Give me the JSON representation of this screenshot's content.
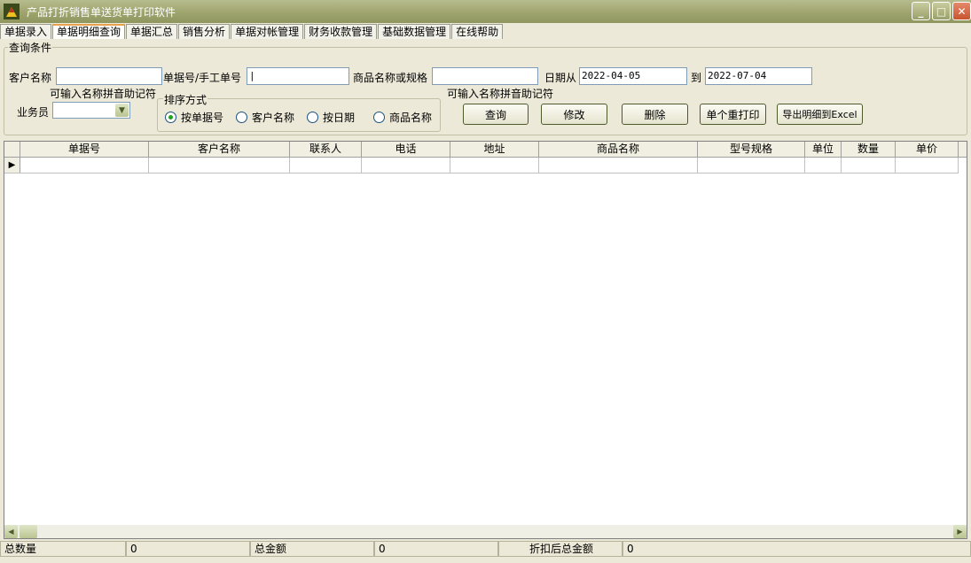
{
  "window": {
    "title": "产品打折销售单送货单打印软件",
    "buttons": {
      "minimize": "_",
      "maximize": "□",
      "close": "✕"
    }
  },
  "tabs": [
    {
      "label": "单据录入"
    },
    {
      "label": "单据明细查询",
      "active": true
    },
    {
      "label": "单据汇总"
    },
    {
      "label": "销售分析"
    },
    {
      "label": "单据对帐管理"
    },
    {
      "label": "财务收款管理"
    },
    {
      "label": "基础数据管理"
    },
    {
      "label": "在线帮助"
    }
  ],
  "query": {
    "group_title": "查询条件",
    "customer_label": "客户名称",
    "customer_value": "",
    "hint_left": "可输入名称拼音助记符",
    "doc_no_label": "单据号/手工单号",
    "doc_no_value": "|",
    "product_label": "商品名称或规格",
    "product_value": "",
    "hint_right": "可输入名称拼音助记符",
    "date_from_label": "日期从",
    "date_from": "2022-04-05",
    "date_to_label": "到",
    "date_to": "2022-07-04",
    "salesman_label": "业务员",
    "salesman_value": ""
  },
  "sort": {
    "title": "排序方式",
    "options": [
      "按单据号",
      "客户名称",
      "按日期",
      "商品名称"
    ],
    "selected": 0
  },
  "buttons": {
    "query": "查询",
    "edit": "修改",
    "delete": "删除",
    "reprint": "单个重打印",
    "export": "导出明细到Excel"
  },
  "grid": {
    "columns": [
      "单据号",
      "客户名称",
      "联系人",
      "电话",
      "地址",
      "商品名称",
      "型号规格",
      "单位",
      "数量",
      "单价"
    ],
    "row_marker": "▶"
  },
  "status": {
    "total_qty_label": "总数量",
    "total_qty": "0",
    "total_amount_label": "总金额",
    "total_amount": "0",
    "discount_total_label": "折扣后总金额",
    "discount_total": "0"
  },
  "colors": {
    "title_bar": "#a3a873",
    "accent_tab": "#e8a04a",
    "radio_dot": "#21a121"
  }
}
